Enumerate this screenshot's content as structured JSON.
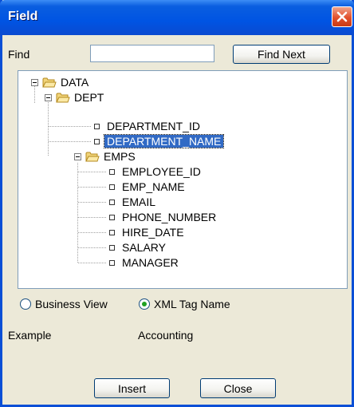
{
  "dialog": {
    "title": "Field",
    "find_label": "Find",
    "find_value": "",
    "find_next_label": "Find Next",
    "tree": [
      {
        "label": "DATA",
        "type": "folder",
        "expanded": true,
        "level": 0
      },
      {
        "label": "DEPT",
        "type": "folder",
        "expanded": true,
        "level": 1
      },
      {
        "label": "DEPARTMENT_ID",
        "type": "field",
        "level": 2
      },
      {
        "label": "DEPARTMENT_NAME",
        "type": "field",
        "level": 2,
        "selected": true
      },
      {
        "label": "EMPS",
        "type": "folder",
        "expanded": true,
        "level": 2
      },
      {
        "label": "EMPLOYEE_ID",
        "type": "field",
        "level": 3
      },
      {
        "label": "EMP_NAME",
        "type": "field",
        "level": 3
      },
      {
        "label": "EMAIL",
        "type": "field",
        "level": 3
      },
      {
        "label": "PHONE_NUMBER",
        "type": "field",
        "level": 3
      },
      {
        "label": "HIRE_DATE",
        "type": "field",
        "level": 3
      },
      {
        "label": "SALARY",
        "type": "field",
        "level": 3
      },
      {
        "label": "MANAGER",
        "type": "field",
        "level": 3
      }
    ],
    "view_options": [
      {
        "label": "Business View",
        "checked": false
      },
      {
        "label": "XML Tag Name",
        "checked": true
      }
    ],
    "example_label": "Example",
    "example_value": "Accounting",
    "insert_label": "Insert",
    "close_label": "Close"
  },
  "colors": {
    "titlebar": "#0054e3",
    "selection": "#316ac5",
    "close_button": "#e2502c",
    "radio_dot": "#21a121"
  }
}
